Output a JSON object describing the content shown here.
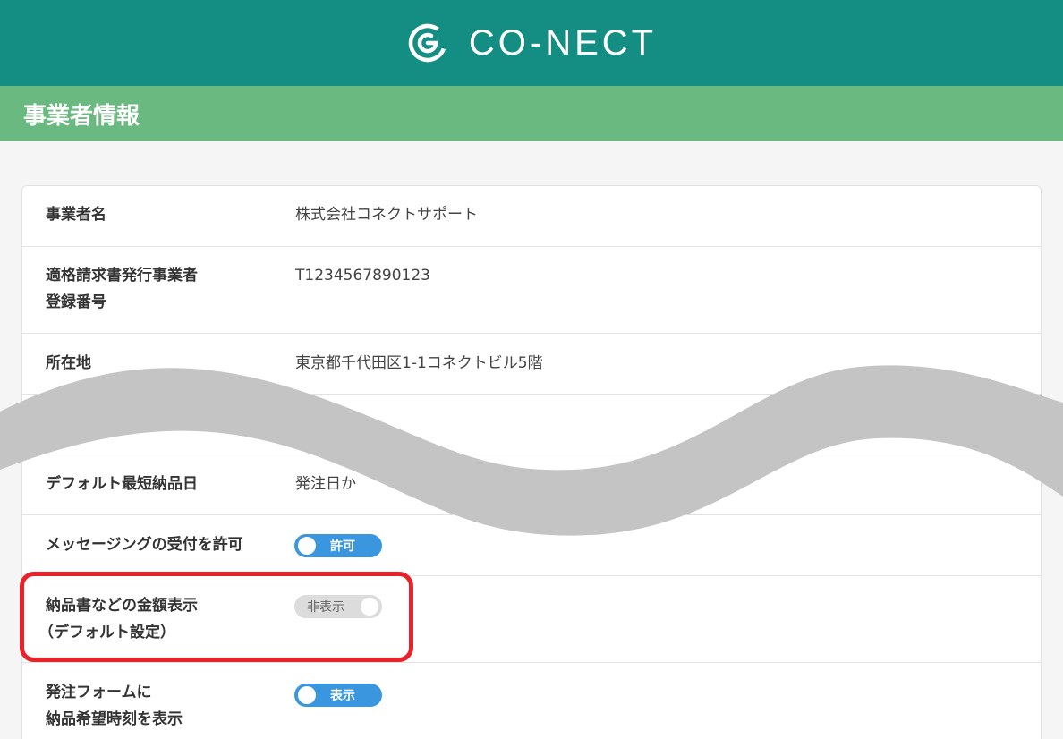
{
  "header": {
    "logo_text": "CO-NECT",
    "icon": "conect-logo-icon"
  },
  "section": {
    "title": "事業者情報"
  },
  "rows": [
    {
      "label": "事業者名",
      "value": "株式会社コネクトサポート"
    },
    {
      "label_line1": "適格請求書発行事業者",
      "label_line2": "登録番号",
      "value": "T1234567890123"
    },
    {
      "label": "所在地",
      "value": "東京都千代田区1-1コネクトビル5階"
    },
    {
      "label": "デフォルト最短納品日",
      "value": "発注日か"
    },
    {
      "label": "メッセージングの受付を許可",
      "toggle_label": "許可",
      "toggle_state": "on"
    },
    {
      "label_line1": "納品書などの金額表示",
      "label_line2": "（デフォルト設定）",
      "toggle_label": "非表示",
      "toggle_state": "off"
    },
    {
      "label_line1": "発注フォームに",
      "label_line2": "納品希望時刻を表示",
      "toggle_label": "表示",
      "toggle_state": "on"
    }
  ],
  "colors": {
    "header": "#148e83",
    "section": "#6ab981",
    "toggle_on": "#3b96e0",
    "highlight": "#e8222a"
  }
}
